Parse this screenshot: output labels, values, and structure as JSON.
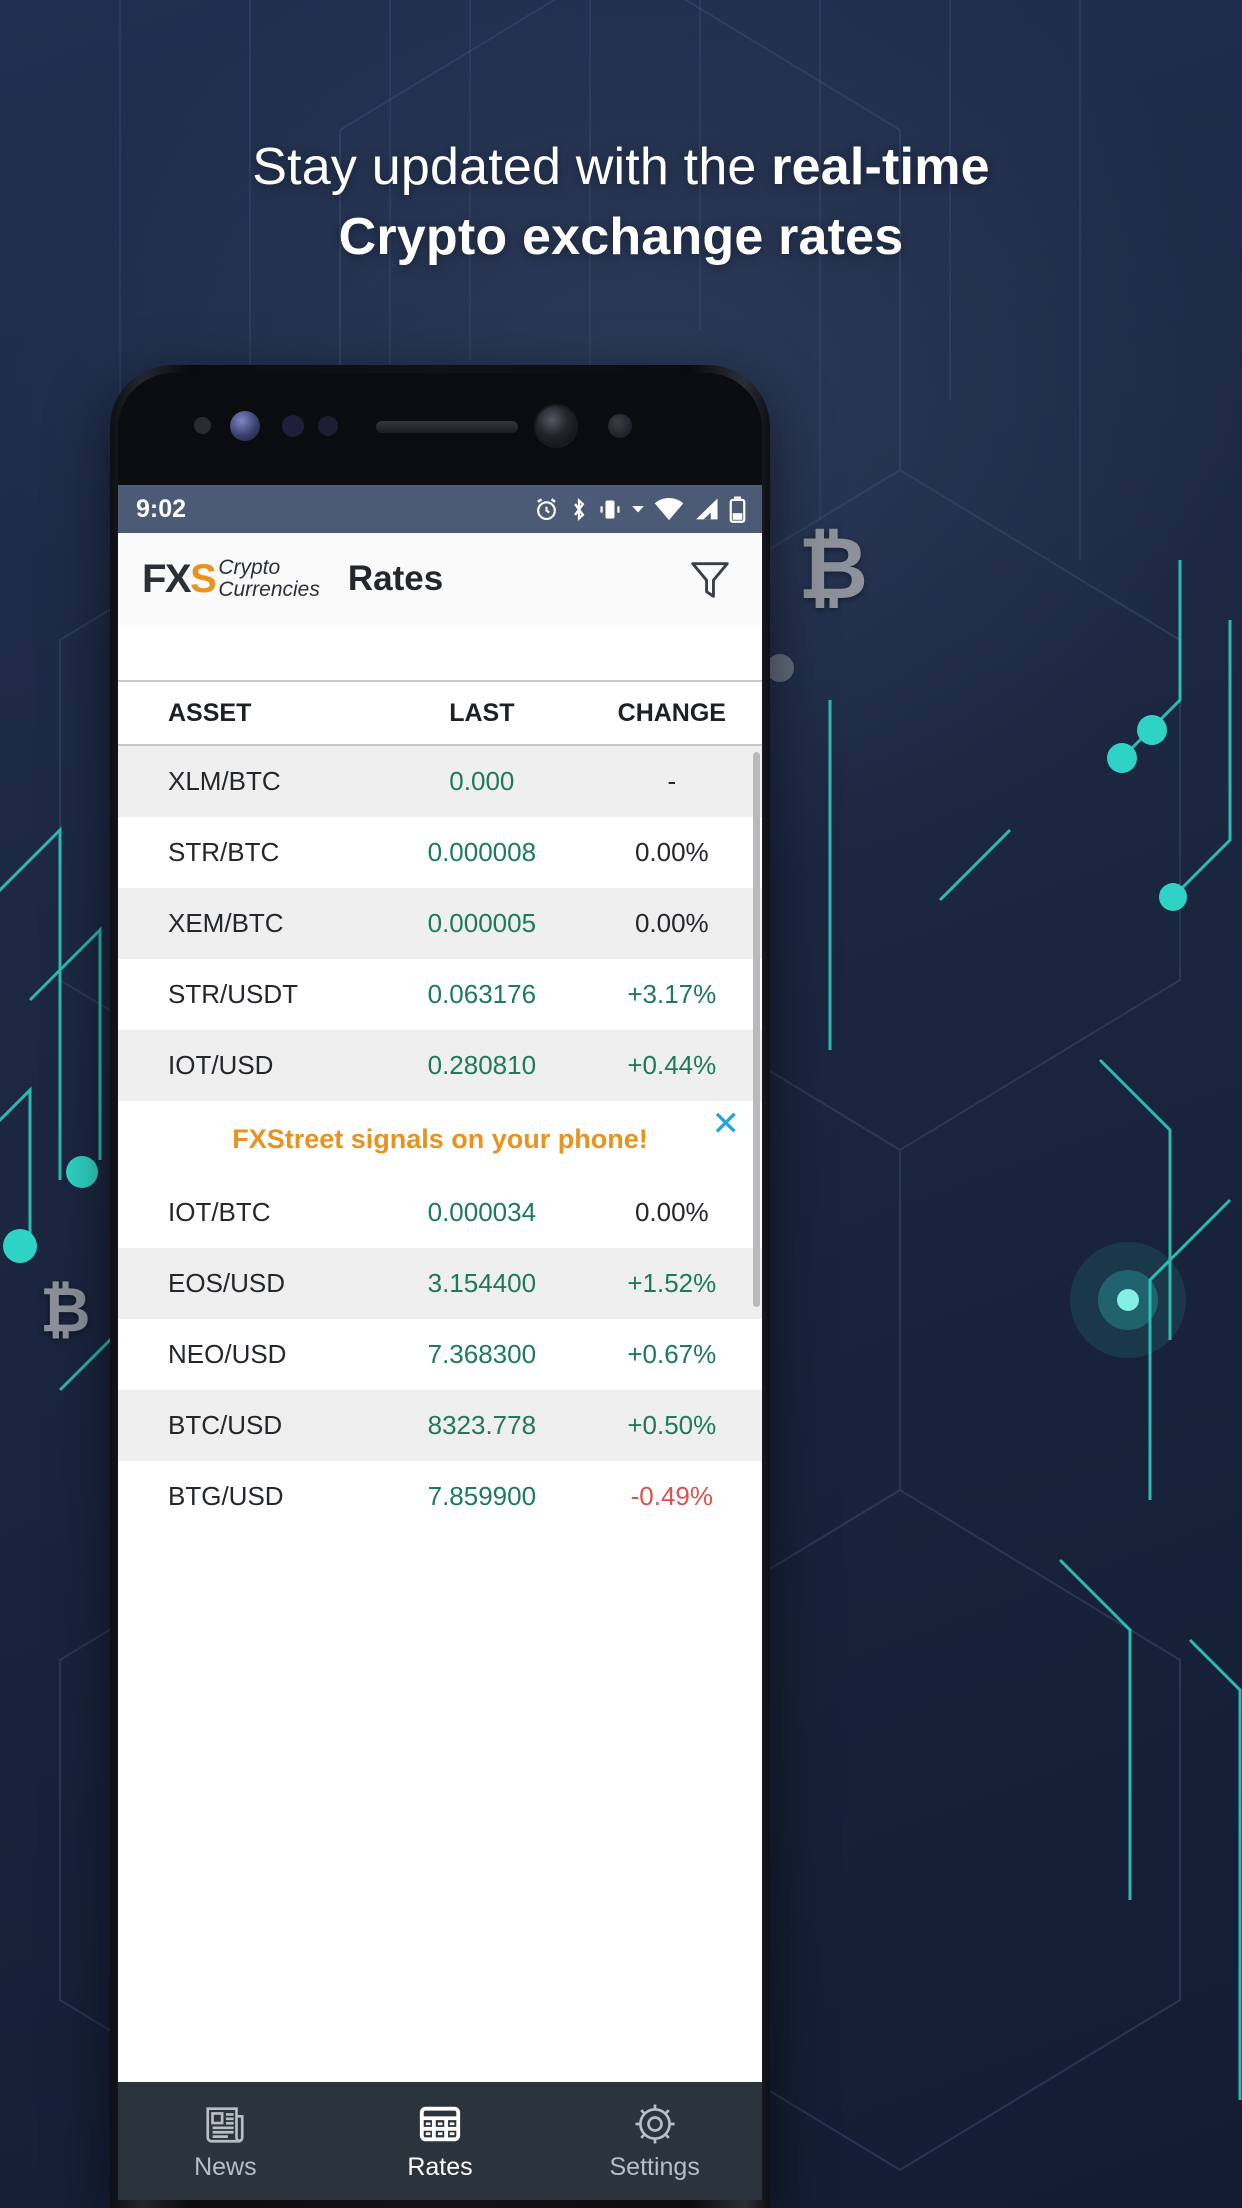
{
  "promo": {
    "headline_line1_normal": "Stay updated with the ",
    "headline_line1_bold": "real-time",
    "headline_line2": "Crypto exchange rates"
  },
  "statusbar": {
    "time": "9:02",
    "icons": [
      "alarm-icon",
      "bluetooth-icon",
      "vibrate-icon",
      "wifi-icon",
      "signal-icon",
      "battery-icon"
    ]
  },
  "appbar": {
    "logo_mark": "FXS",
    "logo_sub_line1": "Crypto",
    "logo_sub_line2": "Currencies",
    "title": "Rates",
    "filter_icon": "filter-funnel-icon"
  },
  "table": {
    "headers": {
      "asset": "ASSET",
      "last": "LAST",
      "change": "CHANGE"
    },
    "rows": [
      {
        "asset": "XLM/BTC",
        "last": "0.000",
        "change": "-",
        "dir": "flat"
      },
      {
        "asset": "STR/BTC",
        "last": "0.000008",
        "change": "0.00%",
        "dir": "flat"
      },
      {
        "asset": "XEM/BTC",
        "last": "0.000005",
        "change": "0.00%",
        "dir": "flat"
      },
      {
        "asset": "STR/USDT",
        "last": "0.063176",
        "change": "+3.17%",
        "dir": "up"
      },
      {
        "asset": "IOT/USD",
        "last": "0.280810",
        "change": "+0.44%",
        "dir": "up"
      },
      {
        "asset": "IOT/BTC",
        "last": "0.000034",
        "change": "0.00%",
        "dir": "flat"
      },
      {
        "asset": "EOS/USD",
        "last": "3.154400",
        "change": "+1.52%",
        "dir": "up"
      },
      {
        "asset": "NEO/USD",
        "last": "7.368300",
        "change": "+0.67%",
        "dir": "up"
      },
      {
        "asset": "BTC/USD",
        "last": "8323.778",
        "change": "+0.50%",
        "dir": "up"
      },
      {
        "asset": "BTG/USD",
        "last": "7.859900",
        "change": "-0.49%",
        "dir": "down"
      }
    ]
  },
  "ad": {
    "text": "FXStreet signals on your phone!",
    "close_label": "✕",
    "close_icon": "close-icon"
  },
  "bottomnav": {
    "items": [
      {
        "label": "News",
        "icon": "newspaper-icon",
        "active": false
      },
      {
        "label": "Rates",
        "icon": "grid-table-icon",
        "active": true
      },
      {
        "label": "Settings",
        "icon": "gear-icon",
        "active": false
      }
    ]
  },
  "colors": {
    "accent_orange": "#e8921f",
    "up_green": "#1d7a5d",
    "down_red": "#d9534f",
    "statusbar_bg": "#4b5b75",
    "nav_bg": "#2b333d",
    "page_bg": "#1c2740",
    "link_blue": "#22a6e0"
  }
}
